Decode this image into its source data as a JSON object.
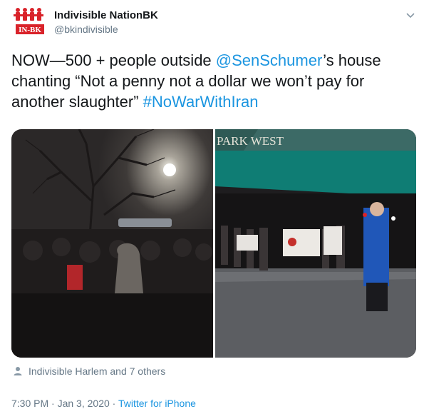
{
  "account": {
    "name": "Indivisible NationBK",
    "handle": "@bkindivisible",
    "avatar_text": "IN-BK"
  },
  "tweet": {
    "text_part1": "NOW—500 + people outside ",
    "mention": "@SenSchumer",
    "text_part2": "’s house chanting “Not a penny not a dollar we won’t pay for another slaughter” ",
    "hashtag": "#NoWarWithIran"
  },
  "photos": {
    "right_sign": "PARK WEST"
  },
  "tagged": {
    "text": "Indivisible Harlem and 7 others"
  },
  "meta": {
    "time": "7:30 PM",
    "separator": " · ",
    "date": "Jan 3, 2020",
    "source": "Twitter for iPhone"
  },
  "colors": {
    "link": "#1b95e0",
    "secondary_text": "#657786",
    "brand_red": "#d9232a"
  },
  "icons": {
    "caret": "chevron-down-icon",
    "tagged": "person-icon"
  }
}
